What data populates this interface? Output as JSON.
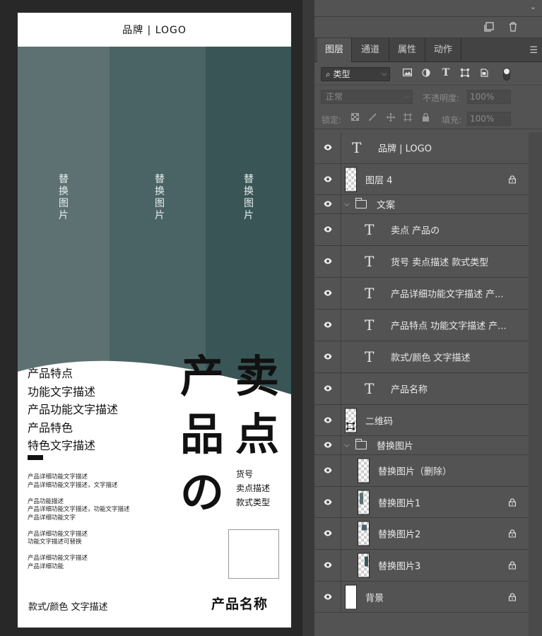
{
  "artboard": {
    "brand": "品牌 | LOGO",
    "image_placeholders": [
      "替换图片",
      "替换图片",
      "替换图片"
    ],
    "colors": {
      "img1": "#5d7172",
      "img2": "#4a6465",
      "img3": "#3a5556"
    },
    "features": [
      "产品特点",
      "功能文字描述",
      "产品功能文字描述",
      "产品特色",
      "特色文字描述"
    ],
    "details": [
      [
        "产品详细功能文字描述",
        "产品详细功能文字描述，文字描述"
      ],
      [
        "产品功能描述",
        "产品详细功能文字描述，功能文字描述",
        "产品详细功能文字"
      ],
      [
        "产品详细功能文字描述",
        "功能文字描述可替换"
      ],
      [
        "产品详细功能文字描述",
        "产品详细功能"
      ]
    ],
    "big_chars": [
      "卖",
      "点",
      "产",
      "品",
      "の"
    ],
    "sell_meta": [
      "货号",
      "卖点描述",
      "款式类型"
    ],
    "style_desc": "款式/颜色  文字描述",
    "product_name": "产品名称"
  },
  "panel": {
    "tabs": [
      "图层",
      "通道",
      "属性",
      "动作"
    ],
    "kind_filter": "类型",
    "blend_mode": "正常",
    "opacity_label": "不透明度:",
    "opacity_value": "100%",
    "lock_label": "锁定:",
    "fill_label": "填充:",
    "fill_value": "100%",
    "layers": [
      {
        "name": "品牌 | LOGO",
        "type": "text",
        "indent": 0,
        "locked": false
      },
      {
        "name": "图层 4",
        "type": "pixel",
        "indent": 0,
        "locked": true
      },
      {
        "name": "文案",
        "type": "group",
        "indent": 0,
        "locked": false
      },
      {
        "name": "卖点 产品の",
        "type": "text",
        "indent": 1,
        "locked": false
      },
      {
        "name": "货号 卖点描述 款式类型",
        "type": "text",
        "indent": 1,
        "locked": false
      },
      {
        "name": "产品详细功能文字描述 产...",
        "type": "text",
        "indent": 1,
        "locked": false
      },
      {
        "name": "产品特点 功能文字描述 产...",
        "type": "text",
        "indent": 1,
        "locked": false
      },
      {
        "name": "款式/颜色 文字描述",
        "type": "text",
        "indent": 1,
        "locked": false
      },
      {
        "name": "产品名称",
        "type": "text",
        "indent": 1,
        "locked": false
      },
      {
        "name": "二维码",
        "type": "pixel",
        "indent": 0,
        "locked": false
      },
      {
        "name": "替换图片",
        "type": "group",
        "indent": 0,
        "locked": false
      },
      {
        "name": "替换图片（删除）",
        "type": "pixel",
        "indent": 1,
        "locked": false
      },
      {
        "name": "替换图片1",
        "type": "pixel",
        "indent": 1,
        "locked": true
      },
      {
        "name": "替换图片2",
        "type": "pixel",
        "indent": 1,
        "locked": true
      },
      {
        "name": "替换图片3",
        "type": "pixel",
        "indent": 1,
        "locked": true
      },
      {
        "name": "背景",
        "type": "white",
        "indent": 0,
        "locked": true
      }
    ]
  }
}
